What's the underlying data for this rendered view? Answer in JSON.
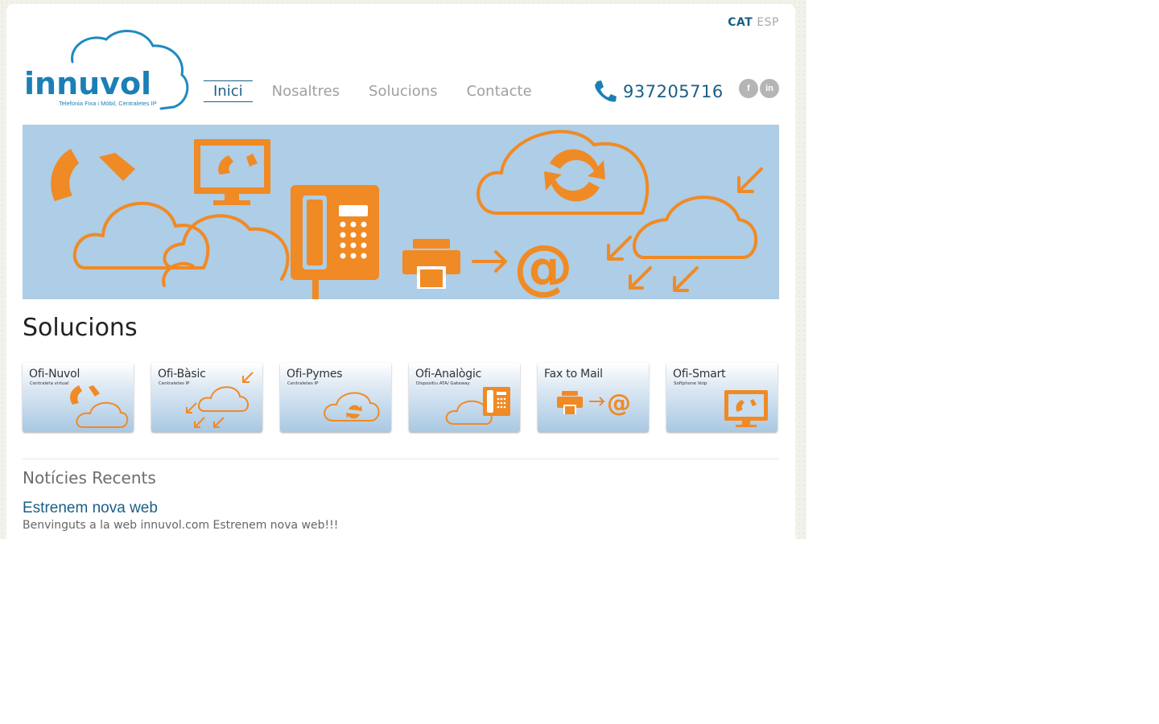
{
  "header": {
    "languages": [
      {
        "label": "CAT",
        "active": true
      },
      {
        "label": "ESP",
        "active": false
      }
    ],
    "logo": {
      "wordmark": "innuvol",
      "tagline": "Telefonia Fixa i Mòbil, Centraletes IP"
    },
    "nav": [
      {
        "label": "Inici",
        "active": true
      },
      {
        "label": "Nosaltres",
        "active": false
      },
      {
        "label": "Solucions",
        "active": false
      },
      {
        "label": "Contacte",
        "active": false
      }
    ],
    "phone": {
      "icon": "phone-icon",
      "number": "937205716"
    },
    "social": [
      {
        "icon": "facebook-icon",
        "glyph": "f"
      },
      {
        "icon": "linkedin-icon",
        "glyph": "in"
      }
    ]
  },
  "banner": {
    "icons": [
      "phone-handset-icon",
      "monitor-phone-icon",
      "cloud-icon",
      "desk-phone-icon",
      "fax-icon",
      "arrow-right-icon",
      "at-icon",
      "cloud-sync-icon",
      "arrows-in-icon"
    ]
  },
  "solutions": {
    "title": "Solucions",
    "tiles": [
      {
        "title": "Ofi-Nuvol",
        "subtitle": "Centraleta virtual",
        "icon": "phone-cloud-icon"
      },
      {
        "title": "Ofi-Bàsic",
        "subtitle": "Centraletes IP",
        "icon": "cloud-arrows-icon"
      },
      {
        "title": "Ofi-Pymes",
        "subtitle": "Centraletes IP",
        "icon": "cloud-sync-icon"
      },
      {
        "title": "Ofi-Analògic",
        "subtitle": "Dispositiu ATA/ Gateway",
        "icon": "cloud-deskphone-icon"
      },
      {
        "title": "Fax to Mail",
        "subtitle": "",
        "icon": "fax-to-mail-icon"
      },
      {
        "title": "Ofi-Smart",
        "subtitle": "Softphone Voip",
        "icon": "monitor-phone-icon"
      }
    ]
  },
  "news": {
    "heading": "Notícies Recents",
    "items": [
      {
        "title": "Estrenem nova web",
        "excerpt": "Benvinguts a la web innuvol.com Estrenem nova web!!!"
      }
    ]
  },
  "colors": {
    "brand_blue": "#1a5f87",
    "accent_orange": "#f08a24",
    "banner_blue": "#aecde6"
  }
}
